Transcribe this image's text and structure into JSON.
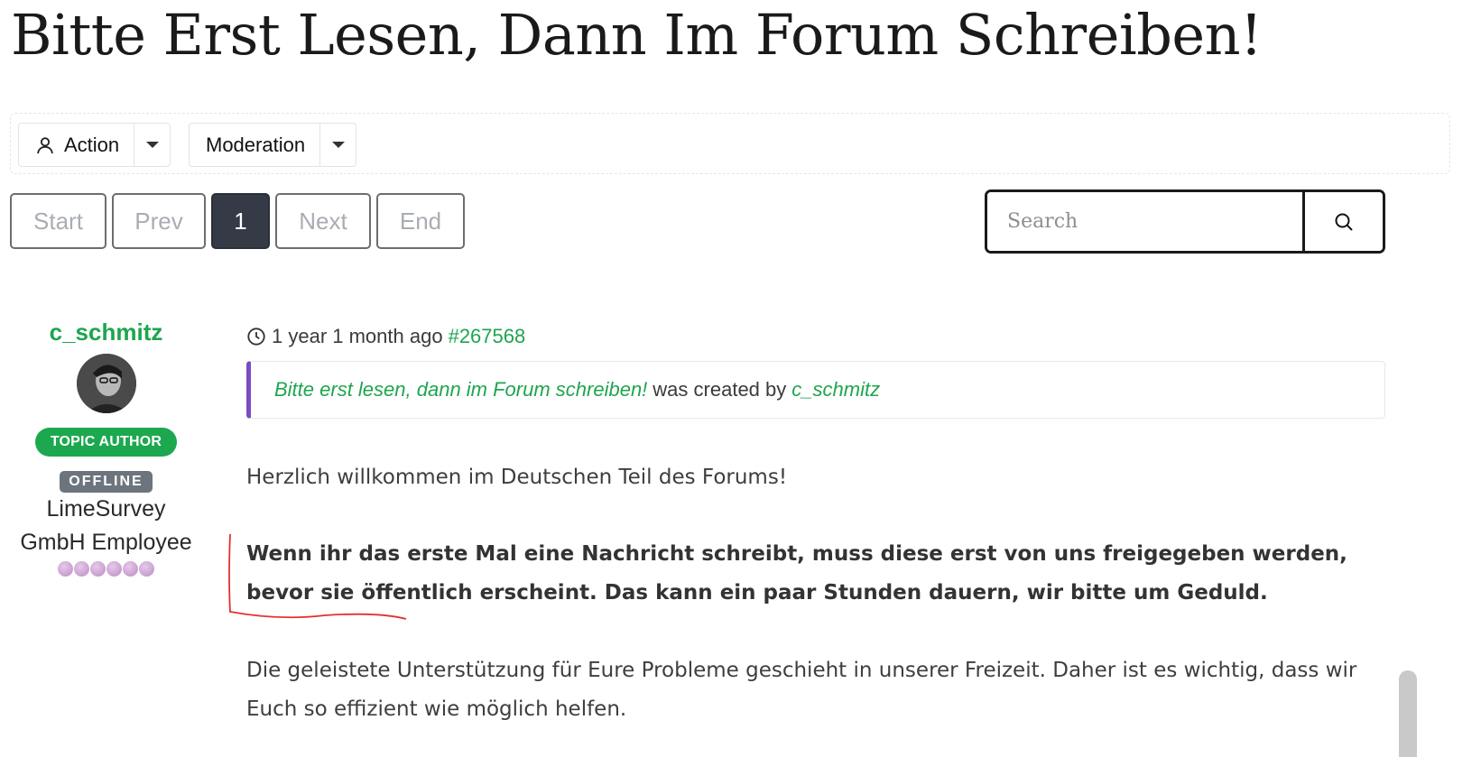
{
  "page": {
    "title": "Bitte Erst Lesen, Dann Im Forum Schreiben!"
  },
  "toolbar": {
    "action_label": "Action",
    "action_icon": "user-icon",
    "moderation_label": "Moderation"
  },
  "pagination": {
    "start": "Start",
    "prev": "Prev",
    "current": "1",
    "next": "Next",
    "end": "End"
  },
  "search": {
    "placeholder": "Search",
    "icon": "search-icon"
  },
  "post": {
    "author": {
      "name": "c_schmitz",
      "badge": "TOPIC AUTHOR",
      "status": "OFFLINE",
      "role_line1": "LimeSurvey",
      "role_line2": "GmbH Employee",
      "rank_dots": 6
    },
    "time": "1 year 1 month ago",
    "id": "#267568",
    "created": {
      "topic": "Bitte erst lesen, dann im Forum schreiben!",
      "text": "was created by",
      "user": "c_schmitz"
    },
    "paragraphs": {
      "p1": "Herzlich willkommen im Deutschen Teil des Forums!",
      "p2": "Wenn ihr das erste Mal eine Nachricht schreibt, muss diese erst von uns freigegeben werden, bevor sie öffentlich erscheint. Das kann ein paar Stunden dauern, wir bitte um Geduld.",
      "p3": "Die geleistete Unterstützung für Eure Probleme geschieht in unserer Freizeit. Daher ist es wichtig, dass wir Euch so effizient wie möglich helfen."
    }
  },
  "colors": {
    "accent_green": "#1ea54e",
    "quote_border": "#7b4bc4",
    "active_page": "#343a46",
    "annotation": "#e53030"
  }
}
